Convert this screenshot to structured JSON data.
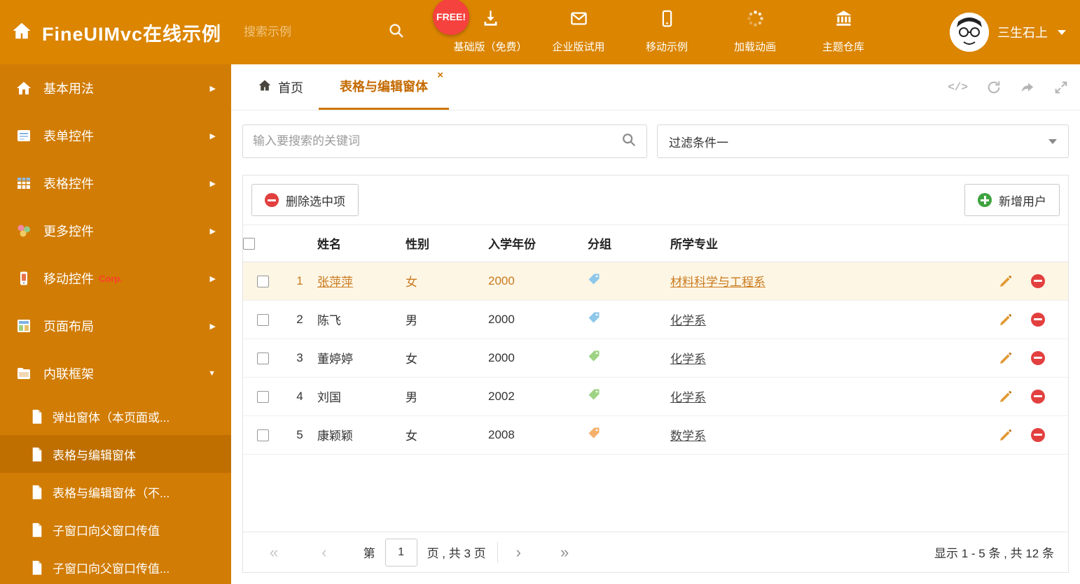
{
  "header": {
    "title": "FineUIMvc在线示例",
    "search_placeholder": "搜索示例",
    "free_badge": "FREE!",
    "nav_items": [
      {
        "label": "基础版（免费）"
      },
      {
        "label": "企业版试用"
      },
      {
        "label": "移动示例"
      },
      {
        "label": "加载动画"
      },
      {
        "label": "主题仓库"
      }
    ],
    "username": "三生石上"
  },
  "sidebar": {
    "items": [
      {
        "label": "基本用法"
      },
      {
        "label": "表单控件"
      },
      {
        "label": "表格控件"
      },
      {
        "label": "更多控件"
      },
      {
        "label": "移动控件",
        "badge": "Corp."
      },
      {
        "label": "页面布局"
      },
      {
        "label": "内联框架"
      }
    ],
    "subitems": [
      {
        "label": "弹出窗体（本页面或..."
      },
      {
        "label": "表格与编辑窗体"
      },
      {
        "label": "表格与编辑窗体（不..."
      },
      {
        "label": "子窗口向父窗口传值"
      },
      {
        "label": "子窗口向父窗口传值..."
      }
    ]
  },
  "tabs": {
    "home": "首页",
    "active": "表格与编辑窗体"
  },
  "filters": {
    "search_placeholder": "输入要搜索的关键词",
    "filter_value": "过滤条件一"
  },
  "toolbar": {
    "delete_label": "删除选中项",
    "add_label": "新增用户"
  },
  "table": {
    "headers": {
      "name": "姓名",
      "gender": "性别",
      "year": "入学年份",
      "group": "分组",
      "major": "所学专业"
    },
    "rows": [
      {
        "num": "1",
        "name": "张萍萍",
        "gender": "女",
        "year": "2000",
        "tag_color": "blue",
        "major": "材料科学与工程系",
        "selected": true
      },
      {
        "num": "2",
        "name": "陈飞",
        "gender": "男",
        "year": "2000",
        "tag_color": "blue",
        "major": "化学系",
        "selected": false
      },
      {
        "num": "3",
        "name": "董婷婷",
        "gender": "女",
        "year": "2000",
        "tag_color": "green",
        "major": "化学系",
        "selected": false
      },
      {
        "num": "4",
        "name": "刘国",
        "gender": "男",
        "year": "2002",
        "tag_color": "green",
        "major": "化学系",
        "selected": false
      },
      {
        "num": "5",
        "name": "康颖颖",
        "gender": "女",
        "year": "2008",
        "tag_color": "orange",
        "major": "数学系",
        "selected": false
      }
    ]
  },
  "pagination": {
    "page_prefix": "第",
    "page_value": "1",
    "page_suffix": "页 , 共 3 页",
    "summary": "显示 1 - 5 条 , 共 12 条"
  },
  "icons": {
    "chevron_right": "▶",
    "chevron_down": "▼",
    "close": "×",
    "code": "</>",
    "pg_first": "«",
    "pg_prev": "‹",
    "pg_next": "›",
    "pg_last": "»"
  },
  "colors": {
    "header_bg": "#db8500",
    "sidebar_bg": "#d17c04",
    "sidebar_selected_bg": "#bf6f00",
    "accent": "#cf7600",
    "free_badge_bg": "#f5423e",
    "row_selected_bg": "#fdf6e5",
    "row_selected_text": "#ca7a1e",
    "tag_blue": "#8ec7ea",
    "tag_green": "#9ed383",
    "tag_orange": "#f4b06a",
    "delete_red": "#e2403f",
    "add_green": "#3fa33f"
  }
}
